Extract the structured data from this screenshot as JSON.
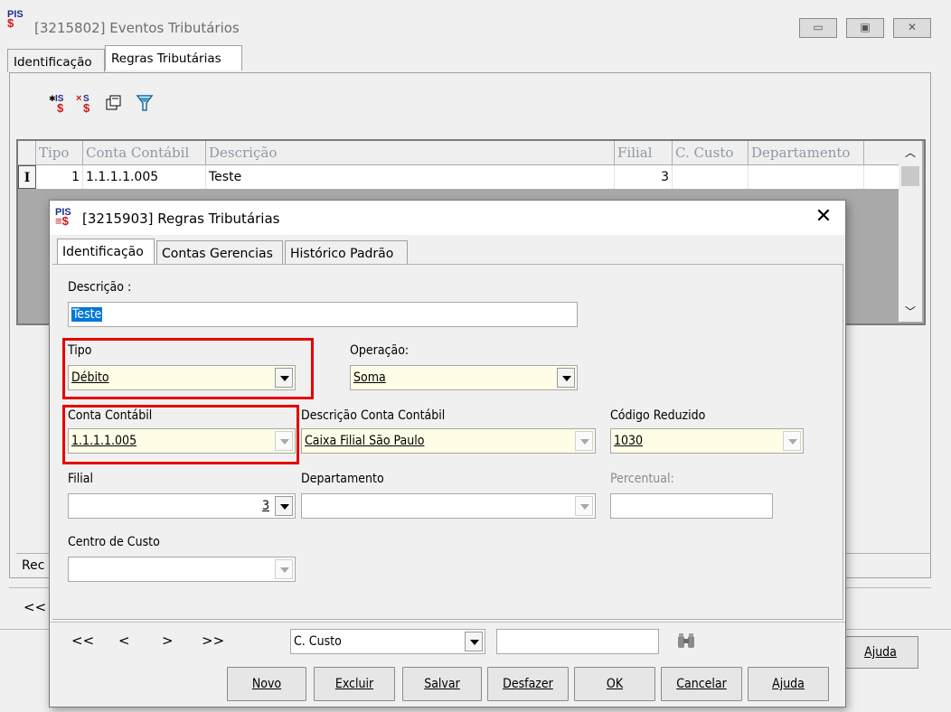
{
  "back": {
    "title_code": "[3215802]",
    "title": "Eventos Tributários",
    "tabs": [
      "Identificação",
      "Regras Tributárias"
    ],
    "grid": {
      "columns": [
        "Tipo",
        "Conta Contábil",
        "Descrição",
        "Filial",
        "C. Custo",
        "Departamento"
      ],
      "row": {
        "marker": "I",
        "tipo": "1",
        "conta": "1.1.1.1.005",
        "descricao": "Teste",
        "filial": "3",
        "ccusto": "",
        "departamento": ""
      }
    },
    "rec_label": "Rec",
    "nav_first": "<<",
    "help_button": "Ajuda"
  },
  "dialog": {
    "title_code": "[3215903]",
    "title": "Regras Tributárias",
    "tabs": [
      "Identificação",
      "Contas Gerencias",
      "Histórico Padrão"
    ],
    "fields": {
      "descricao_label": "Descrição :",
      "descricao_value": "Teste",
      "tipo_label": "Tipo",
      "tipo_value": "Débito",
      "operacao_label": "Operação:",
      "operacao_value": "Soma",
      "conta_label": "Conta Contábil",
      "conta_value": "1.1.1.1.005",
      "desc_conta_label": "Descrição Conta Contábil",
      "desc_conta_value": "Caixa Filial São Paulo",
      "codigo_label": "Código Reduzido",
      "codigo_value": "1030",
      "filial_label": "Filial",
      "filial_value": "3",
      "departamento_label": "Departamento",
      "departamento_value": "",
      "percentual_label": "Percentual:",
      "percentual_value": "",
      "centro_label": "Centro de Custo",
      "centro_value": ""
    },
    "nav": {
      "first": "<<",
      "prev": "<",
      "next": ">",
      "last": ">>",
      "search_field": "C. Custo",
      "search_value": ""
    },
    "buttons": [
      "Novo",
      "Excluir",
      "Salvar",
      "Desfazer",
      "OK",
      "Cancelar",
      "Ajuda"
    ]
  },
  "colors": {
    "highlight": "#e60000",
    "required_bg": "#fffde6",
    "selection": "#0078d7"
  }
}
